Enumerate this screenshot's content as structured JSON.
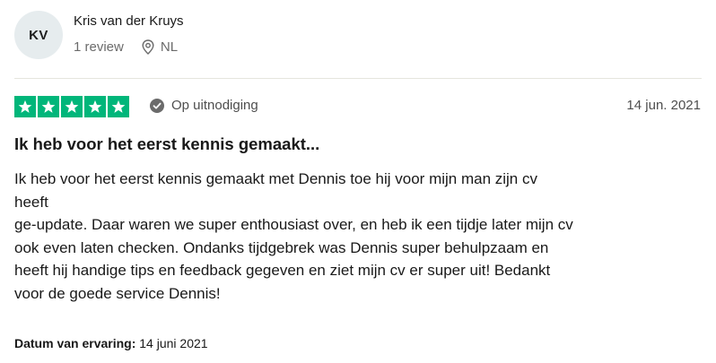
{
  "reviewer": {
    "initials": "KV",
    "name": "Kris van der Kruys",
    "review_count": "1 review",
    "country": "NL"
  },
  "review": {
    "rating": 5,
    "verification_label": "Op uitnodiging",
    "date": "14 jun. 2021",
    "title": "Ik heb voor het eerst kennis gemaakt...",
    "body_lines": [
      "Ik heb voor het eerst kennis gemaakt met Dennis toe hij voor mijn man zijn cv",
      "heeft",
      "ge-update. Daar waren we super enthousiast over, en heb ik een tijdje later mijn cv",
      "ook even laten checken. Ondanks tijdgebrek was Dennis super behulpzaam en",
      "heeft hij handige tips en feedback gegeven en ziet mijn cv er super uit! Bedankt",
      "voor de goede service Dennis!"
    ],
    "experience_label": "Datum van ervaring:",
    "experience_date": "14 juni 2021"
  },
  "colors": {
    "star_green": "#00b67a",
    "avatar_bg": "#e6ecee",
    "muted_text": "#6b6b6b"
  },
  "icons": {
    "star": "star-icon",
    "location": "location-pin-icon",
    "verified": "check-circle-icon"
  }
}
